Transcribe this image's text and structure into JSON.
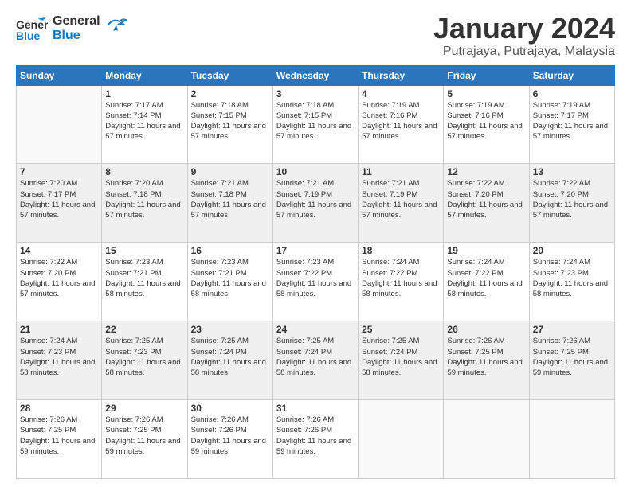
{
  "logo": {
    "part1": "General",
    "part2": "Blue"
  },
  "title": "January 2024",
  "location": "Putrajaya, Putrajaya, Malaysia",
  "days_of_week": [
    "Sunday",
    "Monday",
    "Tuesday",
    "Wednesday",
    "Thursday",
    "Friday",
    "Saturday"
  ],
  "weeks": [
    [
      {
        "day": "",
        "sunrise": "",
        "sunset": "",
        "daylight": ""
      },
      {
        "day": "1",
        "sunrise": "Sunrise: 7:17 AM",
        "sunset": "Sunset: 7:14 PM",
        "daylight": "Daylight: 11 hours and 57 minutes."
      },
      {
        "day": "2",
        "sunrise": "Sunrise: 7:18 AM",
        "sunset": "Sunset: 7:15 PM",
        "daylight": "Daylight: 11 hours and 57 minutes."
      },
      {
        "day": "3",
        "sunrise": "Sunrise: 7:18 AM",
        "sunset": "Sunset: 7:15 PM",
        "daylight": "Daylight: 11 hours and 57 minutes."
      },
      {
        "day": "4",
        "sunrise": "Sunrise: 7:19 AM",
        "sunset": "Sunset: 7:16 PM",
        "daylight": "Daylight: 11 hours and 57 minutes."
      },
      {
        "day": "5",
        "sunrise": "Sunrise: 7:19 AM",
        "sunset": "Sunset: 7:16 PM",
        "daylight": "Daylight: 11 hours and 57 minutes."
      },
      {
        "day": "6",
        "sunrise": "Sunrise: 7:19 AM",
        "sunset": "Sunset: 7:17 PM",
        "daylight": "Daylight: 11 hours and 57 minutes."
      }
    ],
    [
      {
        "day": "7",
        "sunrise": "Sunrise: 7:20 AM",
        "sunset": "Sunset: 7:17 PM",
        "daylight": "Daylight: 11 hours and 57 minutes."
      },
      {
        "day": "8",
        "sunrise": "Sunrise: 7:20 AM",
        "sunset": "Sunset: 7:18 PM",
        "daylight": "Daylight: 11 hours and 57 minutes."
      },
      {
        "day": "9",
        "sunrise": "Sunrise: 7:21 AM",
        "sunset": "Sunset: 7:18 PM",
        "daylight": "Daylight: 11 hours and 57 minutes."
      },
      {
        "day": "10",
        "sunrise": "Sunrise: 7:21 AM",
        "sunset": "Sunset: 7:19 PM",
        "daylight": "Daylight: 11 hours and 57 minutes."
      },
      {
        "day": "11",
        "sunrise": "Sunrise: 7:21 AM",
        "sunset": "Sunset: 7:19 PM",
        "daylight": "Daylight: 11 hours and 57 minutes."
      },
      {
        "day": "12",
        "sunrise": "Sunrise: 7:22 AM",
        "sunset": "Sunset: 7:20 PM",
        "daylight": "Daylight: 11 hours and 57 minutes."
      },
      {
        "day": "13",
        "sunrise": "Sunrise: 7:22 AM",
        "sunset": "Sunset: 7:20 PM",
        "daylight": "Daylight: 11 hours and 57 minutes."
      }
    ],
    [
      {
        "day": "14",
        "sunrise": "Sunrise: 7:22 AM",
        "sunset": "Sunset: 7:20 PM",
        "daylight": "Daylight: 11 hours and 57 minutes."
      },
      {
        "day": "15",
        "sunrise": "Sunrise: 7:23 AM",
        "sunset": "Sunset: 7:21 PM",
        "daylight": "Daylight: 11 hours and 58 minutes."
      },
      {
        "day": "16",
        "sunrise": "Sunrise: 7:23 AM",
        "sunset": "Sunset: 7:21 PM",
        "daylight": "Daylight: 11 hours and 58 minutes."
      },
      {
        "day": "17",
        "sunrise": "Sunrise: 7:23 AM",
        "sunset": "Sunset: 7:22 PM",
        "daylight": "Daylight: 11 hours and 58 minutes."
      },
      {
        "day": "18",
        "sunrise": "Sunrise: 7:24 AM",
        "sunset": "Sunset: 7:22 PM",
        "daylight": "Daylight: 11 hours and 58 minutes."
      },
      {
        "day": "19",
        "sunrise": "Sunrise: 7:24 AM",
        "sunset": "Sunset: 7:22 PM",
        "daylight": "Daylight: 11 hours and 58 minutes."
      },
      {
        "day": "20",
        "sunrise": "Sunrise: 7:24 AM",
        "sunset": "Sunset: 7:23 PM",
        "daylight": "Daylight: 11 hours and 58 minutes."
      }
    ],
    [
      {
        "day": "21",
        "sunrise": "Sunrise: 7:24 AM",
        "sunset": "Sunset: 7:23 PM",
        "daylight": "Daylight: 11 hours and 58 minutes."
      },
      {
        "day": "22",
        "sunrise": "Sunrise: 7:25 AM",
        "sunset": "Sunset: 7:23 PM",
        "daylight": "Daylight: 11 hours and 58 minutes."
      },
      {
        "day": "23",
        "sunrise": "Sunrise: 7:25 AM",
        "sunset": "Sunset: 7:24 PM",
        "daylight": "Daylight: 11 hours and 58 minutes."
      },
      {
        "day": "24",
        "sunrise": "Sunrise: 7:25 AM",
        "sunset": "Sunset: 7:24 PM",
        "daylight": "Daylight: 11 hours and 58 minutes."
      },
      {
        "day": "25",
        "sunrise": "Sunrise: 7:25 AM",
        "sunset": "Sunset: 7:24 PM",
        "daylight": "Daylight: 11 hours and 58 minutes."
      },
      {
        "day": "26",
        "sunrise": "Sunrise: 7:26 AM",
        "sunset": "Sunset: 7:25 PM",
        "daylight": "Daylight: 11 hours and 59 minutes."
      },
      {
        "day": "27",
        "sunrise": "Sunrise: 7:26 AM",
        "sunset": "Sunset: 7:25 PM",
        "daylight": "Daylight: 11 hours and 59 minutes."
      }
    ],
    [
      {
        "day": "28",
        "sunrise": "Sunrise: 7:26 AM",
        "sunset": "Sunset: 7:25 PM",
        "daylight": "Daylight: 11 hours and 59 minutes."
      },
      {
        "day": "29",
        "sunrise": "Sunrise: 7:26 AM",
        "sunset": "Sunset: 7:25 PM",
        "daylight": "Daylight: 11 hours and 59 minutes."
      },
      {
        "day": "30",
        "sunrise": "Sunrise: 7:26 AM",
        "sunset": "Sunset: 7:26 PM",
        "daylight": "Daylight: 11 hours and 59 minutes."
      },
      {
        "day": "31",
        "sunrise": "Sunrise: 7:26 AM",
        "sunset": "Sunset: 7:26 PM",
        "daylight": "Daylight: 11 hours and 59 minutes."
      },
      {
        "day": "",
        "sunrise": "",
        "sunset": "",
        "daylight": ""
      },
      {
        "day": "",
        "sunrise": "",
        "sunset": "",
        "daylight": ""
      },
      {
        "day": "",
        "sunrise": "",
        "sunset": "",
        "daylight": ""
      }
    ]
  ]
}
